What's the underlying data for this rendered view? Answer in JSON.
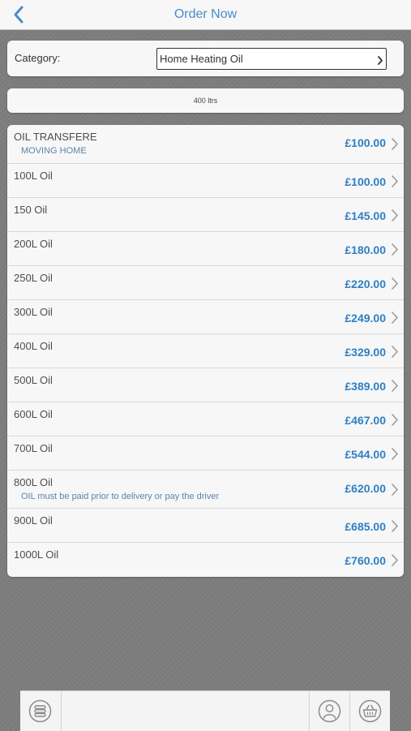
{
  "navbar": {
    "title": "Order Now",
    "back_icon": "chevron-left-icon"
  },
  "category": {
    "label": "Category:",
    "value": "Home Heating Oil"
  },
  "quantity": {
    "text": "400 ltrs"
  },
  "products": [
    {
      "name": "OIL TRANSFERE",
      "note": "MOVING HOME",
      "price": "£100.00"
    },
    {
      "name": "100L Oil",
      "note": "",
      "price": "£100.00"
    },
    {
      "name": "150 Oil",
      "note": "",
      "price": "£145.00"
    },
    {
      "name": "200L Oil",
      "note": "",
      "price": "£180.00"
    },
    {
      "name": "250L Oil",
      "note": "",
      "price": "£220.00"
    },
    {
      "name": "300L Oil",
      "note": "",
      "price": "£249.00"
    },
    {
      "name": "400L Oil",
      "note": "",
      "price": "£329.00"
    },
    {
      "name": "500L Oil",
      "note": "",
      "price": "£389.00"
    },
    {
      "name": "600L Oil",
      "note": "",
      "price": "£467.00"
    },
    {
      "name": "700L Oil",
      "note": "",
      "price": "£544.00"
    },
    {
      "name": "800L Oil",
      "note": "OIL must be paid prior to delivery or pay the driver",
      "price": "£620.00"
    },
    {
      "name": "900L Oil",
      "note": "",
      "price": "£685.00"
    },
    {
      "name": "1000L Oil",
      "note": "",
      "price": "£760.00"
    }
  ],
  "toolbar": {
    "menu_icon": "database-icon",
    "profile_icon": "user-icon",
    "basket_icon": "basket-icon"
  },
  "colors": {
    "accent": "#2f7fc4",
    "nav_title": "#4a8bc9",
    "background": "#7d7d7d",
    "panel": "#f7f7f7"
  }
}
